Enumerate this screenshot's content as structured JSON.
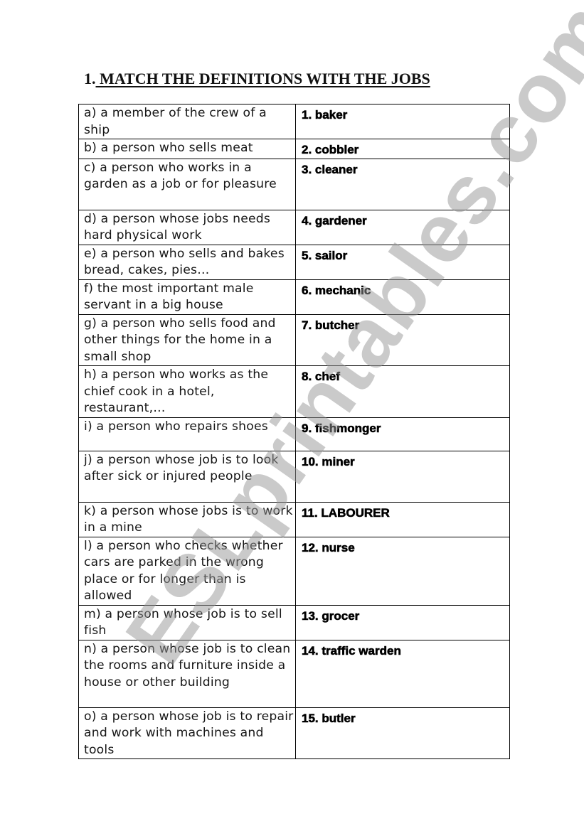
{
  "title": {
    "number": "1.",
    "text": " MATCH THE DEFINITIONS WITH THE JOBS"
  },
  "rows": [
    {
      "definition": "a) a member of  the crew of a ship",
      "job": "1. baker"
    },
    {
      "definition": "b) a person who sells meat",
      "job": "2. cobbler"
    },
    {
      "definition": "c) a person who works in a garden as a job or for pleasure",
      "job": "3. cleaner"
    },
    {
      "definition": "d) a person whose jobs needs hard physical work",
      "job": "4. gardener"
    },
    {
      "definition": "e) a person who sells and bakes bread, cakes, pies…",
      "job": "5. sailor"
    },
    {
      "definition": "f) the most important male servant in a big house",
      "job": "6. mechanic"
    },
    {
      "definition": "g) a person who sells food and other things for the home in a small shop",
      "job": "7. butcher"
    },
    {
      "definition": "h) a person who works as the chief cook in a hotel, restaurant,…",
      "job": "8. chef"
    },
    {
      "definition": "i) a person who repairs shoes",
      "job": "9. fishmonger"
    },
    {
      "definition": "j) a person whose job is to look after sick or injured people",
      "job": "10. miner"
    },
    {
      "definition": "k) a person whose jobs is to work in a mine",
      "job": "11. LABOURER"
    },
    {
      "definition": "l) a person who checks whether cars are parked in the wrong place or for longer than is allowed",
      "job": "12. nurse"
    },
    {
      "definition": "m) a person whose job is to sell fish",
      "job": "13. grocer"
    },
    {
      "definition": "n) a person whose job is to clean the rooms and furniture inside a house or other building",
      "job": "14. traffic warden"
    },
    {
      "definition": "o) a person whose job is to repair and work with machines and tools",
      "job": "15. butler"
    }
  ],
  "watermark": "ESLprintables.com"
}
